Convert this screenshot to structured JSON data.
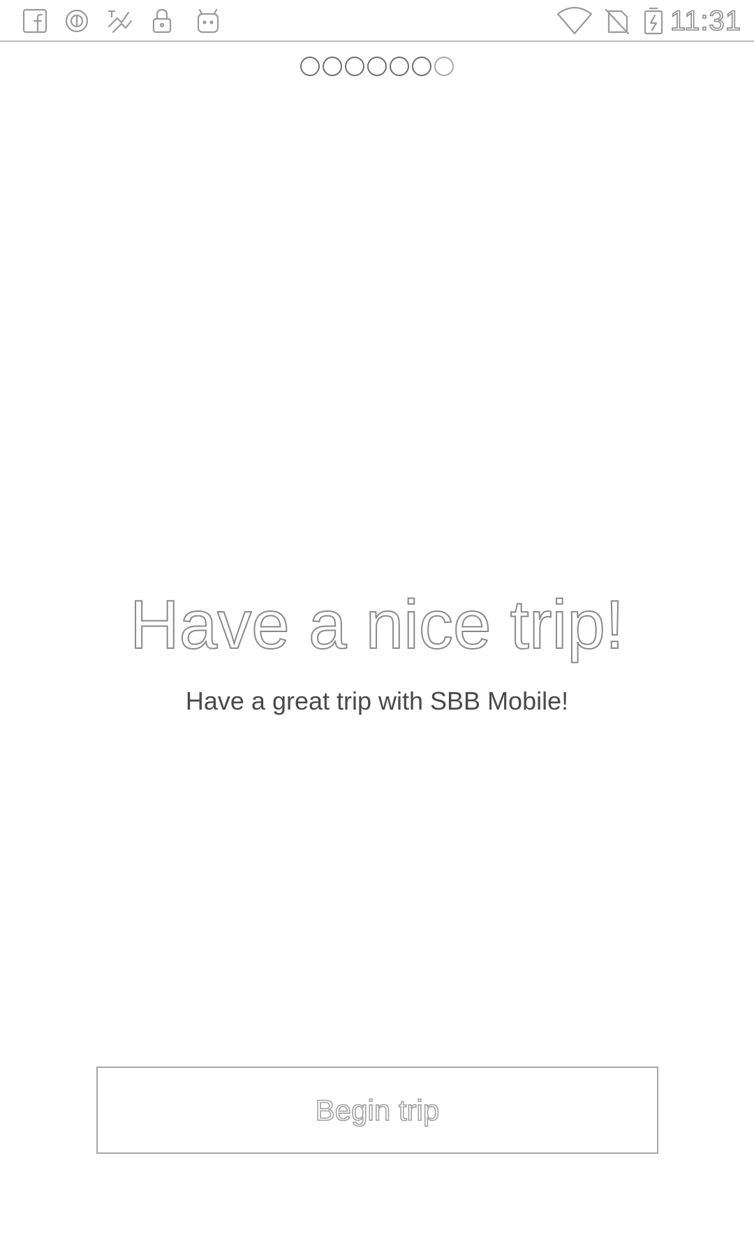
{
  "status_bar": {
    "time": "11:31",
    "left_icons": [
      "facebook-icon",
      "data-saver-icon",
      "nfc-icon",
      "lock-icon",
      "android-icon"
    ],
    "right_icons": [
      "wifi-icon",
      "no-signal-icon",
      "battery-charging-icon"
    ]
  },
  "pager": {
    "count": 7,
    "active_index": 6
  },
  "main": {
    "headline": "Have a nice trip!",
    "subline": "Have a great trip with SBB Mobile!"
  },
  "actions": {
    "begin_label": "Begin trip"
  }
}
